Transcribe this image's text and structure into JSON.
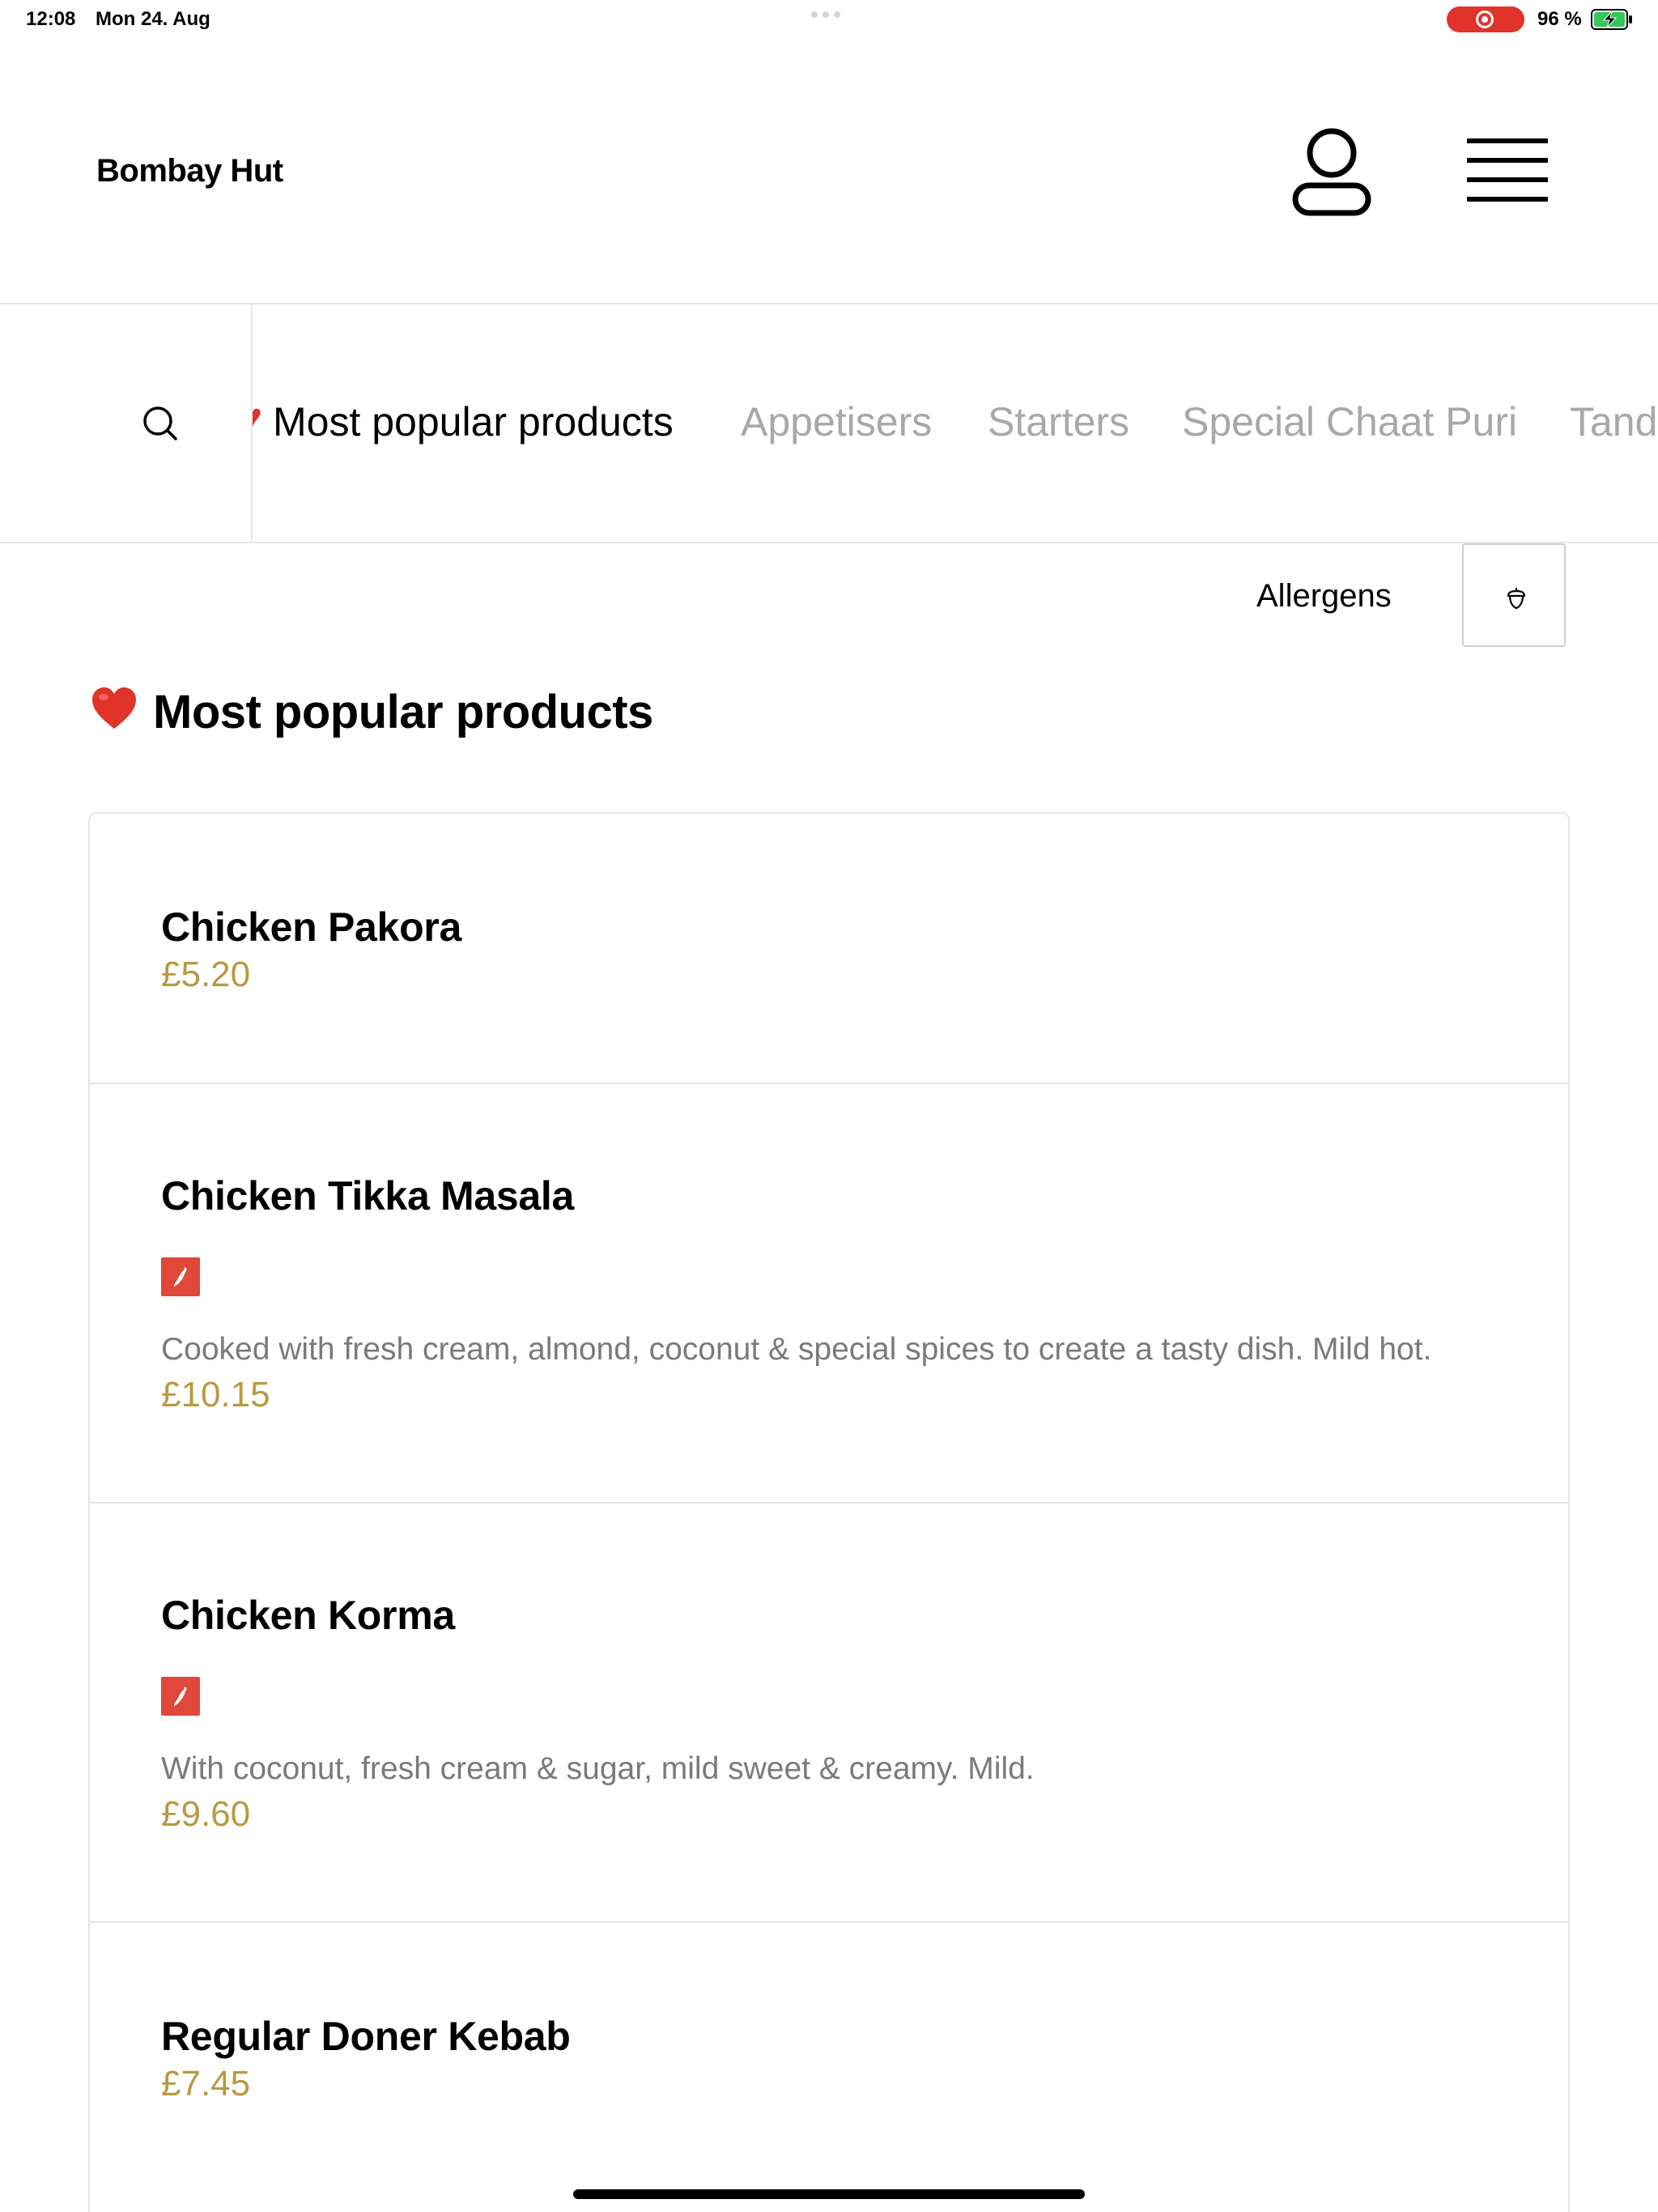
{
  "status_bar": {
    "time": "12:08",
    "date": "Mon 24. Aug",
    "battery": "96 %"
  },
  "header": {
    "brand": "Bombay Hut"
  },
  "tabs": [
    {
      "label": "Most popular products",
      "active": true
    },
    {
      "label": "Appetisers",
      "active": false
    },
    {
      "label": "Starters",
      "active": false
    },
    {
      "label": "Special Chaat Puri",
      "active": false
    },
    {
      "label": "Tand",
      "active": false
    }
  ],
  "allergens": {
    "label": "Allergens"
  },
  "section": {
    "title": "Most popular products"
  },
  "products": [
    {
      "name": "Chicken Pakora",
      "price": "£5.20",
      "description": "",
      "spicy": false
    },
    {
      "name": "Chicken Tikka Masala",
      "price": "£10.15",
      "description": "Cooked with fresh cream, almond, coconut & special spices to create a tasty dish. Mild hot.",
      "spicy": true
    },
    {
      "name": "Chicken Korma",
      "price": "£9.60",
      "description": "With coconut, fresh cream & sugar, mild sweet & creamy. Mild.",
      "spicy": true
    },
    {
      "name": "Regular Doner Kebab",
      "price": "£7.45",
      "description": "",
      "spicy": false
    }
  ],
  "colors": {
    "price": "#b89a41",
    "accent_red": "#e0332a",
    "chili_badge": "#e0493a",
    "inactive_tab": "#a8a8a8"
  },
  "icons": {
    "account": "person-icon",
    "menu": "hamburger-icon",
    "search": "search-icon",
    "allergen": "acorn-icon",
    "spicy": "chili-icon",
    "section": "heart-icon"
  }
}
